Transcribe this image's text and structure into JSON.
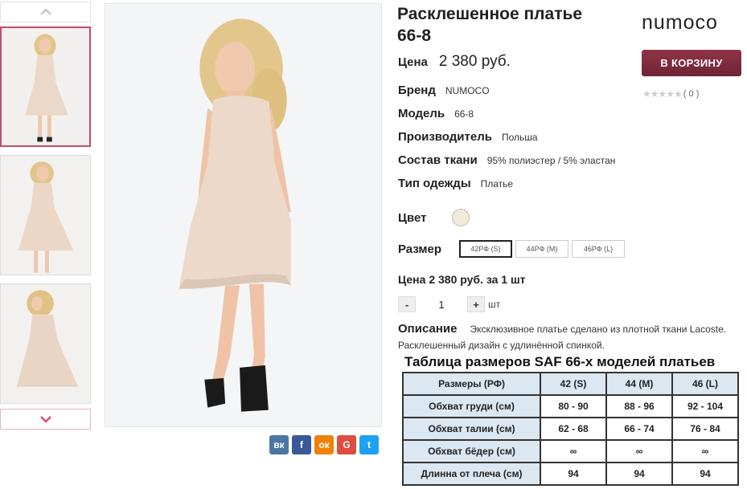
{
  "thumbnails": {
    "up_icon": "chevron-up-icon",
    "down_icon": "chevron-down-icon",
    "items": [
      "front",
      "side",
      "back"
    ]
  },
  "product": {
    "title_line1": "Расклешенное платье",
    "title_line2": "66-8",
    "price_label": "Цена",
    "price_value": "2 380 руб.",
    "brand_logo": "NUMOCO",
    "cart_button": "В КОРЗИНУ",
    "rating_count": "( 0 )",
    "stars": "★★★★★"
  },
  "attributes": [
    {
      "label": "Бренд",
      "value": "NUMOCO"
    },
    {
      "label": "Модель",
      "value": "66-8"
    },
    {
      "label": "Производитель",
      "value": "Польша"
    },
    {
      "label": "Состав ткани",
      "value": "95% полиэстер / 5% эластан"
    },
    {
      "label": "Тип одежды",
      "value": "Платье"
    }
  ],
  "color": {
    "label": "Цвет",
    "swatch": "#f1ead8"
  },
  "size": {
    "label": "Размер",
    "options": [
      "42РФ (S)",
      "44РФ (M)",
      "46РФ (L)"
    ],
    "selected": "42РФ (S)"
  },
  "price_per": "Цена 2 380 руб. за 1 шт",
  "quantity": {
    "minus": "-",
    "value": "1",
    "plus": "+",
    "unit": "шт"
  },
  "description": {
    "label": "Описание",
    "text": "Эксклюзивное платье сделано из плотной ткани Lacoste. Расклешенный дизайн с удлинённой спинкой."
  },
  "size_table": {
    "title": "Таблица размеров SAF 66-х моделей платьев",
    "headers": [
      "Размеры (РФ)",
      "42 (S)",
      "44 (M)",
      "46 (L)"
    ],
    "rows": [
      [
        "Обхват груди (см)",
        "80 - 90",
        "88 - 96",
        "92 - 104"
      ],
      [
        "Обхват талии (см)",
        "62 - 68",
        "66 - 74",
        "76 - 84"
      ],
      [
        "Обхват бёдер (см)",
        "∞",
        "∞",
        "∞"
      ],
      [
        "Длинна от плеча (см)",
        "94",
        "94",
        "94"
      ]
    ]
  },
  "share": [
    {
      "name": "vk-icon",
      "glyph": "вк"
    },
    {
      "name": "facebook-icon",
      "glyph": "f"
    },
    {
      "name": "odnoklassniki-icon",
      "glyph": "ок"
    },
    {
      "name": "google-plus-icon",
      "glyph": "G"
    },
    {
      "name": "twitter-icon",
      "glyph": "t"
    }
  ],
  "colors": {
    "accent": "#c94a64",
    "cart": "#7d2c3f",
    "table_header": "#dbe7f1"
  }
}
